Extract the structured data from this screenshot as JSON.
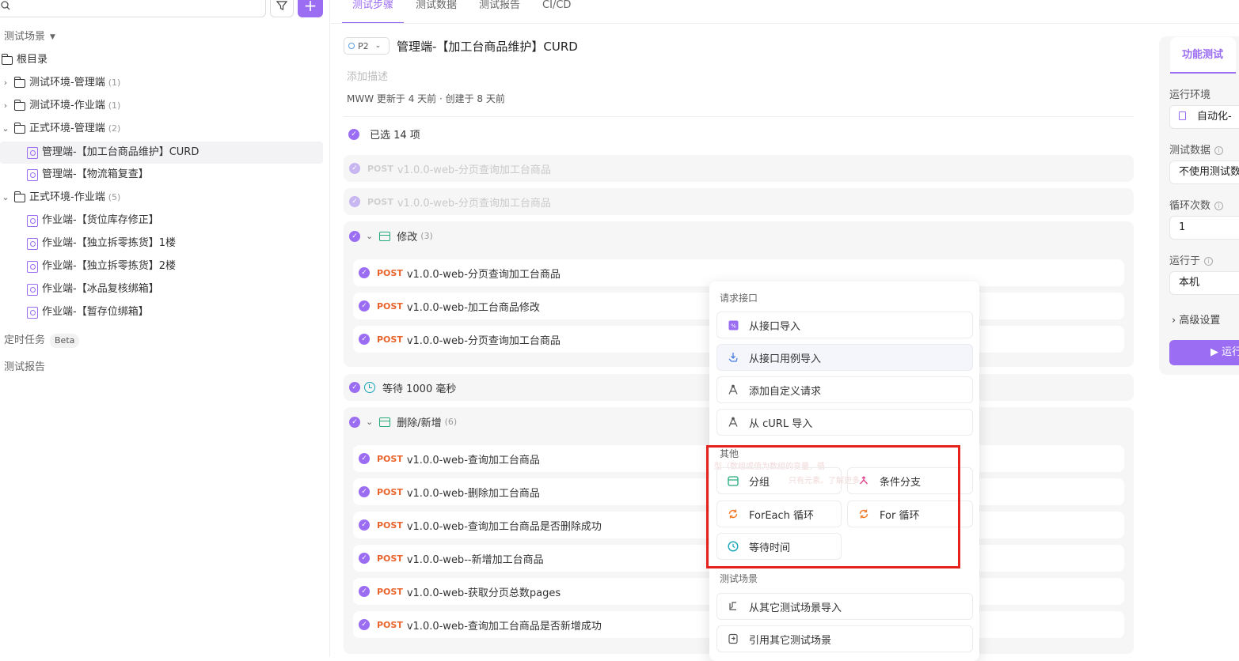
{
  "sidebar": {
    "add_label": "+",
    "section_scenes": "测试场景",
    "root": "根目录",
    "tree": [
      {
        "label": "测试环境-管理端",
        "count": "(1)"
      },
      {
        "label": "测试环境-作业端",
        "count": "(1)"
      },
      {
        "label": "正式环境-管理端",
        "count": "(2)"
      },
      {
        "label": "管理端-【加工台商品维护】CURD"
      },
      {
        "label": "管理端-【物流箱复查】"
      },
      {
        "label": "正式环境-作业端",
        "count": "(5)"
      },
      {
        "label": "作业端-【货位库存修正】"
      },
      {
        "label": "作业端-【独立拆零拣货】1楼"
      },
      {
        "label": "作业端-【独立拆零拣货】2楼"
      },
      {
        "label": "作业端-【冰品复核绑箱】"
      },
      {
        "label": "作业端-【暂存位绑箱】"
      }
    ],
    "scheduled_tasks": "定时任务",
    "beta": "Beta",
    "test_reports": "测试报告"
  },
  "tabs": [
    "测试步骤",
    "测试数据",
    "测试报告",
    "CI/CD"
  ],
  "header": {
    "priority": "P2",
    "title": "管理端-【加工台商品维护】CURD",
    "description_placeholder": "添加描述",
    "meta": "MWW 更新于 4 天前 · 创建于 8 天前"
  },
  "steps": {
    "selected_count": "已选 14 项",
    "method": "POST",
    "faded1": "v1.0.0-web-分页查询加工台商品",
    "faded2": "v1.0.0-web-分页查询加工台商品",
    "group1": {
      "name": "修改",
      "count": "(3)",
      "items": [
        "v1.0.0-web-分页查询加工台商品",
        "v1.0.0-web-加工台商品修改",
        "v1.0.0-web-分页查询加工台商品"
      ]
    },
    "wait": "等待 1000 毫秒",
    "group2": {
      "name": "删除/新增",
      "count": "(6)",
      "items": [
        "v1.0.0-web-查询加工台商品",
        "v1.0.0-web-删除加工台商品",
        "v1.0.0-web-查询加工台商品是否删除成功",
        "v1.0.0-web--新增加工台商品",
        "v1.0.0-web-获取分页总数pages",
        "v1.0.0-web-查询加工台商品是否新增成功"
      ]
    },
    "ghost1": "型（数组或值为数组的变量，循",
    "ghost2": "只有元素。了解更多"
  },
  "right_panel": {
    "tab": "功能测试",
    "env_label": "运行环境",
    "env_value": "自动化-",
    "data_label": "测试数据",
    "data_value": "不使用测试数",
    "loop_label": "循环次数",
    "loop_value": "1",
    "runon_label": "运行于",
    "runon_value": "本机",
    "advanced": "高级设置",
    "run": "运行"
  },
  "menu": {
    "sec_request": "请求接口",
    "import_api": "从接口导入",
    "import_case": "从接口用例导入",
    "custom_request": "添加自定义请求",
    "import_curl": "从 cURL 导入",
    "sec_other": "其他",
    "group": "分组",
    "condition": "条件分支",
    "foreach": "ForEach 循环",
    "for_loop": "For 循环",
    "wait_time": "等待时间",
    "sec_scene": "测试场景",
    "import_scene": "从其它测试场景导入",
    "ref_scene": "引用其它测试场景"
  },
  "colors": {
    "accent": "#9b6df2",
    "method": "#e8642c",
    "highlight": "#e3231c"
  }
}
